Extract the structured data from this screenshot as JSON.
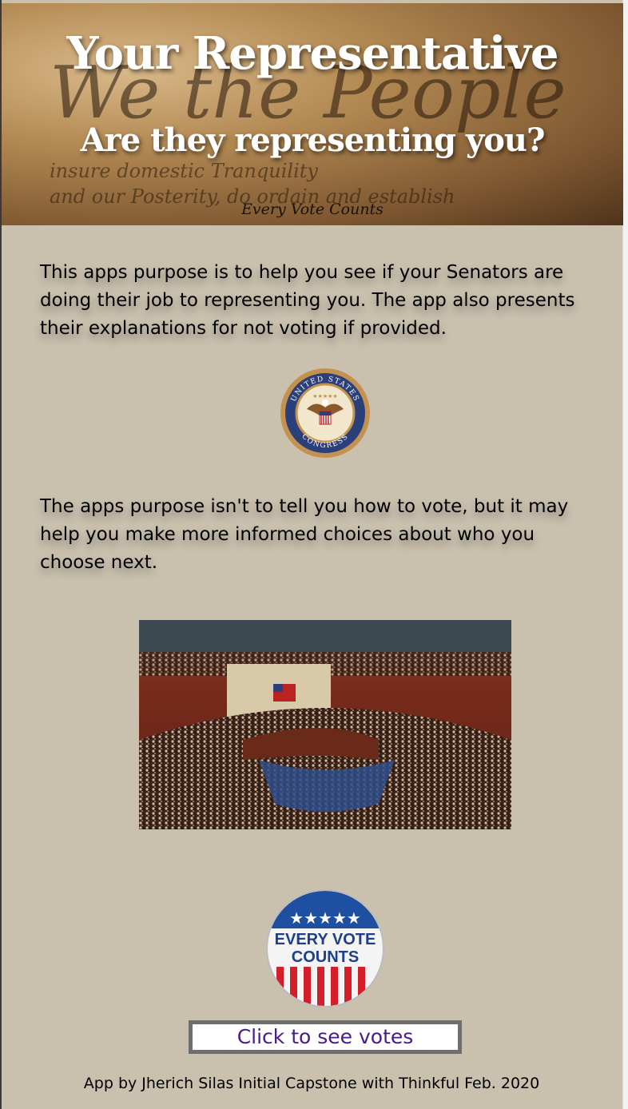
{
  "header": {
    "title": "Your Representative",
    "subtitle": "Are they representing you?",
    "tagline": "Every Vote Counts",
    "background_script": [
      "We the People",
      "insure domestic Tranquility",
      "and our Posterity, do ordain and establish"
    ]
  },
  "intro": {
    "paragraph1": "This apps purpose is to help you see if your Senators are doing their job to representing you. The app also presents their explanations for not voting if provided.",
    "paragraph2": "The apps purpose isn't to tell you how to vote, but it may help you make more informed choices about who you choose next."
  },
  "seal": {
    "ring_top": "UNITED STATES",
    "ring_bottom": "CONGRESS"
  },
  "badge": {
    "line1": "EVERY VOTE",
    "line2": "COUNTS"
  },
  "cta": {
    "label": "Click to see votes"
  },
  "footer": {
    "credit": "App by Jherich Silas Initial Capstone with Thinkful Feb. 2020"
  },
  "colors": {
    "page_bg": "#c9c0ae",
    "link": "#4a1a8a",
    "button_border": "#6e6e6e"
  }
}
